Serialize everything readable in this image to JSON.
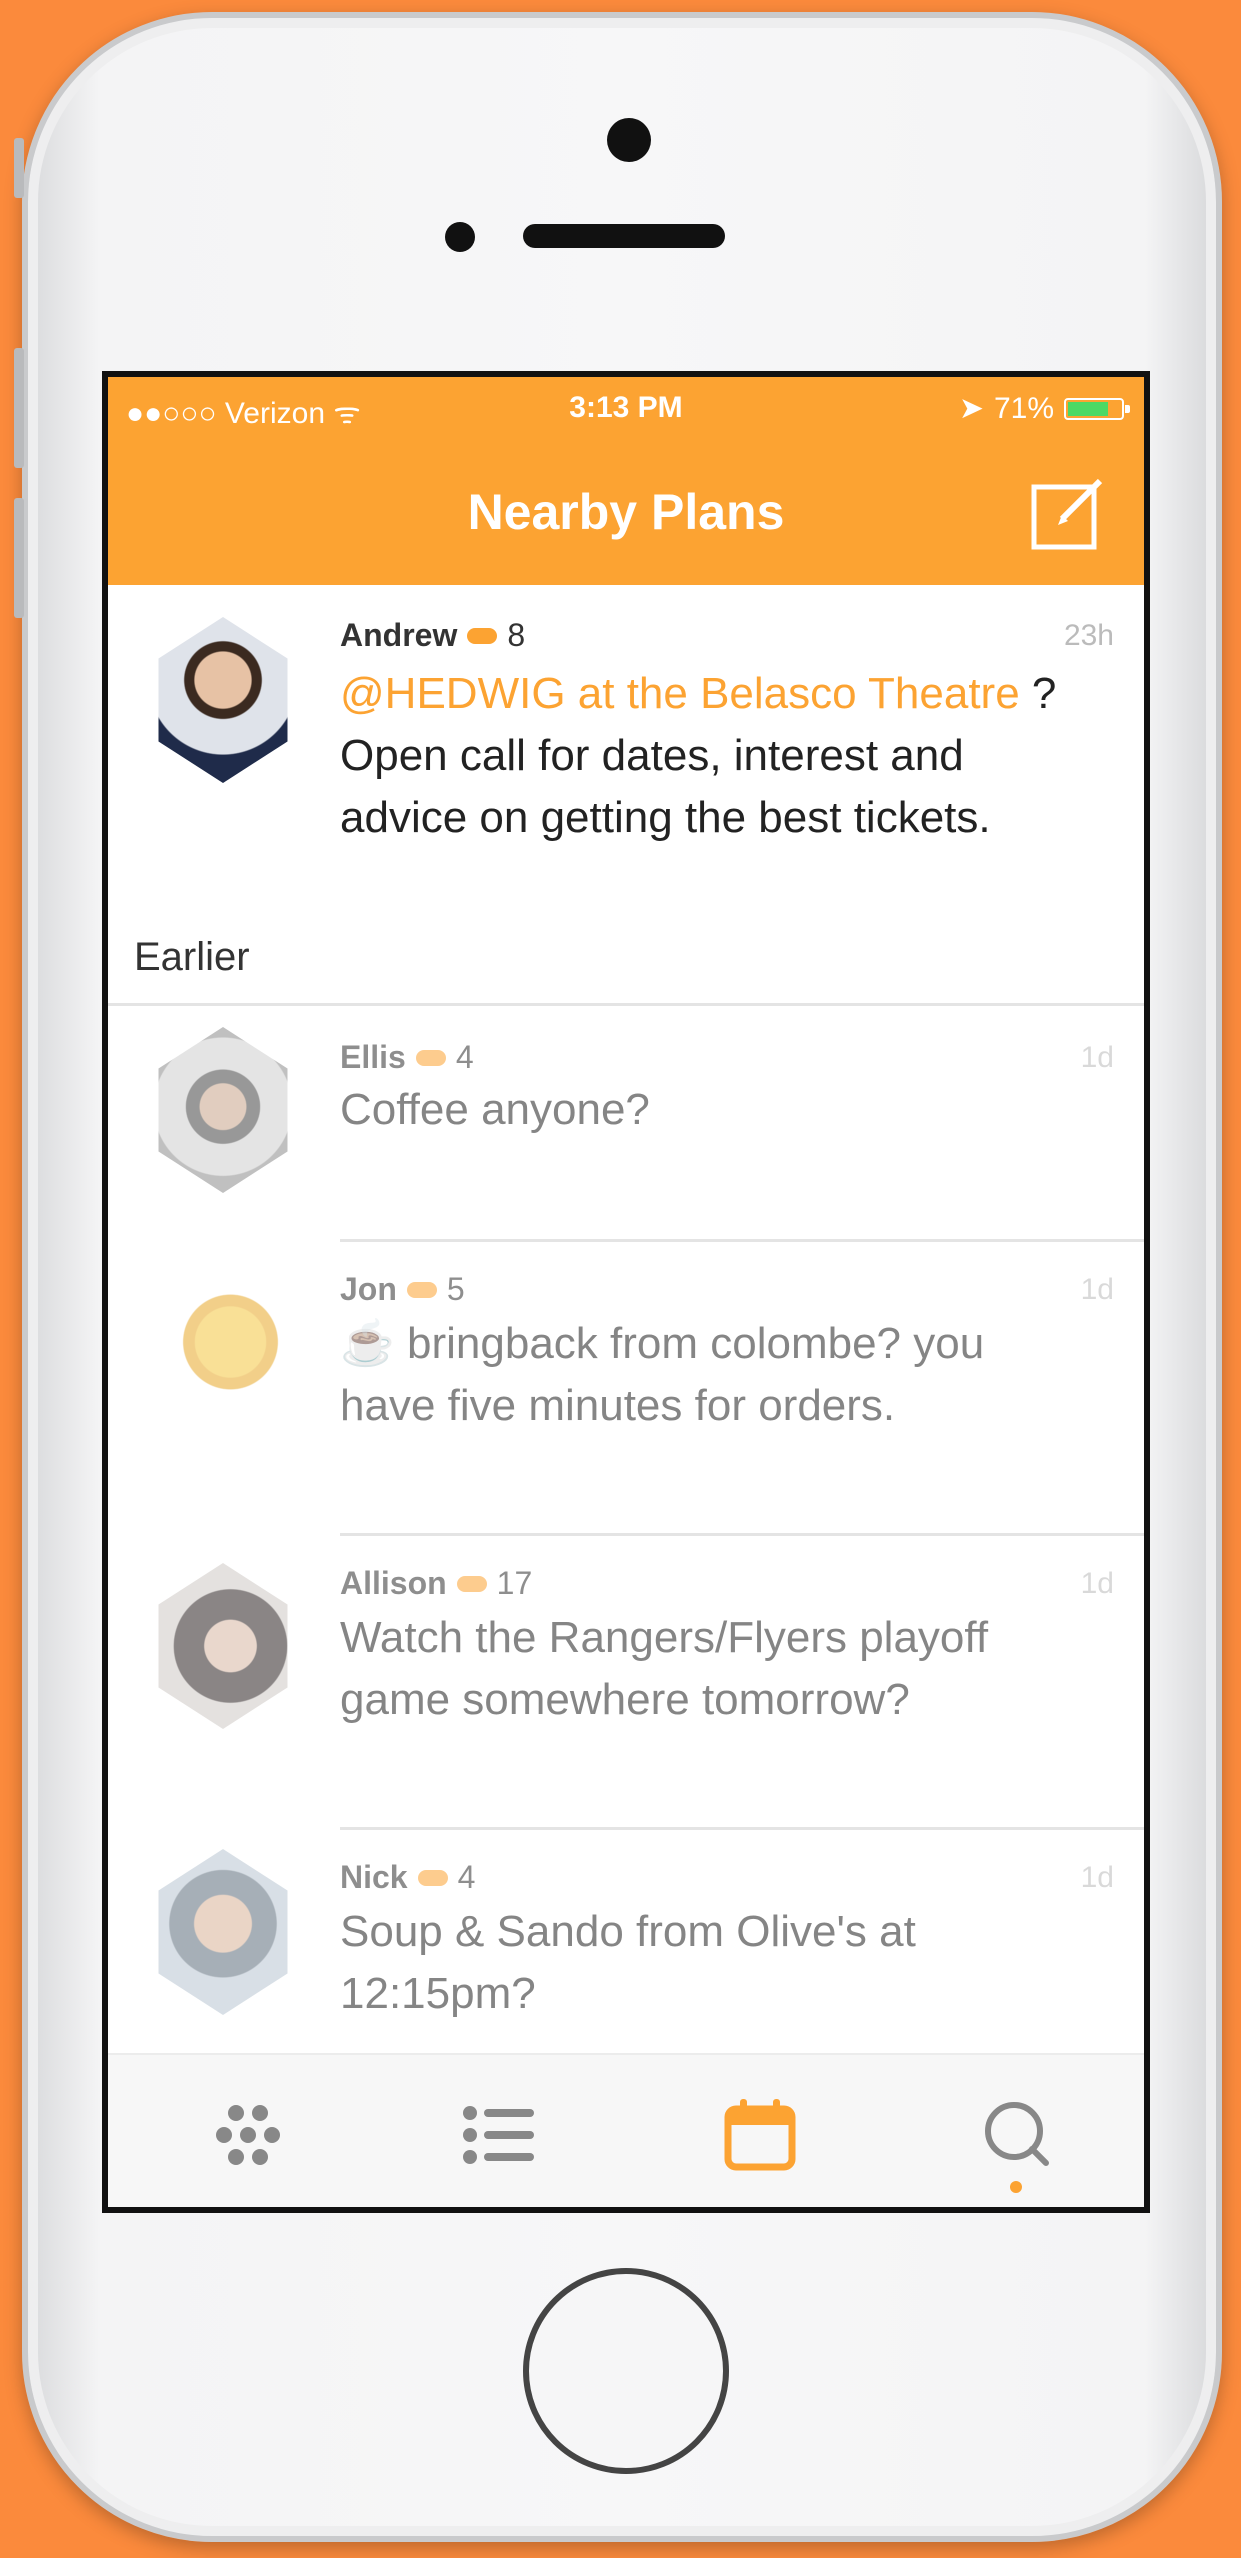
{
  "status_bar": {
    "carrier": "●●○○○ Verizon ᯤ",
    "time": "3:13 PM",
    "battery": "71%",
    "battery_level": 0.71
  },
  "nav": {
    "title": "Nearby Plans",
    "compose_icon": "compose-icon"
  },
  "posts": [
    {
      "name": "Andrew",
      "count": "8",
      "time": "23h",
      "link": "@HEDWIG at the Belasco Theatre",
      "text": " ? Open call for dates, interest and advice on getting the best tickets."
    }
  ],
  "section_label": "Earlier",
  "earlier_posts": [
    {
      "name": "Ellis",
      "count": "4",
      "time": "1d",
      "text": "Coffee anyone?"
    },
    {
      "name": "Jon",
      "count": "5",
      "time": "1d",
      "text": "☕ bringback from colombe? you have five minutes for orders."
    },
    {
      "name": "Allison",
      "count": "17",
      "time": "1d",
      "text": "Watch the Rangers/Flyers playoff game somewhere tomorrow?"
    },
    {
      "name": "Nick",
      "count": "4",
      "time": "1d",
      "text": "Soup & Sando from Olive's at 12:15pm?"
    }
  ],
  "tabs": [
    "grid-icon",
    "list-icon",
    "calendar-icon",
    "search-icon"
  ],
  "colors": {
    "accent": "#fca332",
    "background": "#fb8a3c"
  }
}
